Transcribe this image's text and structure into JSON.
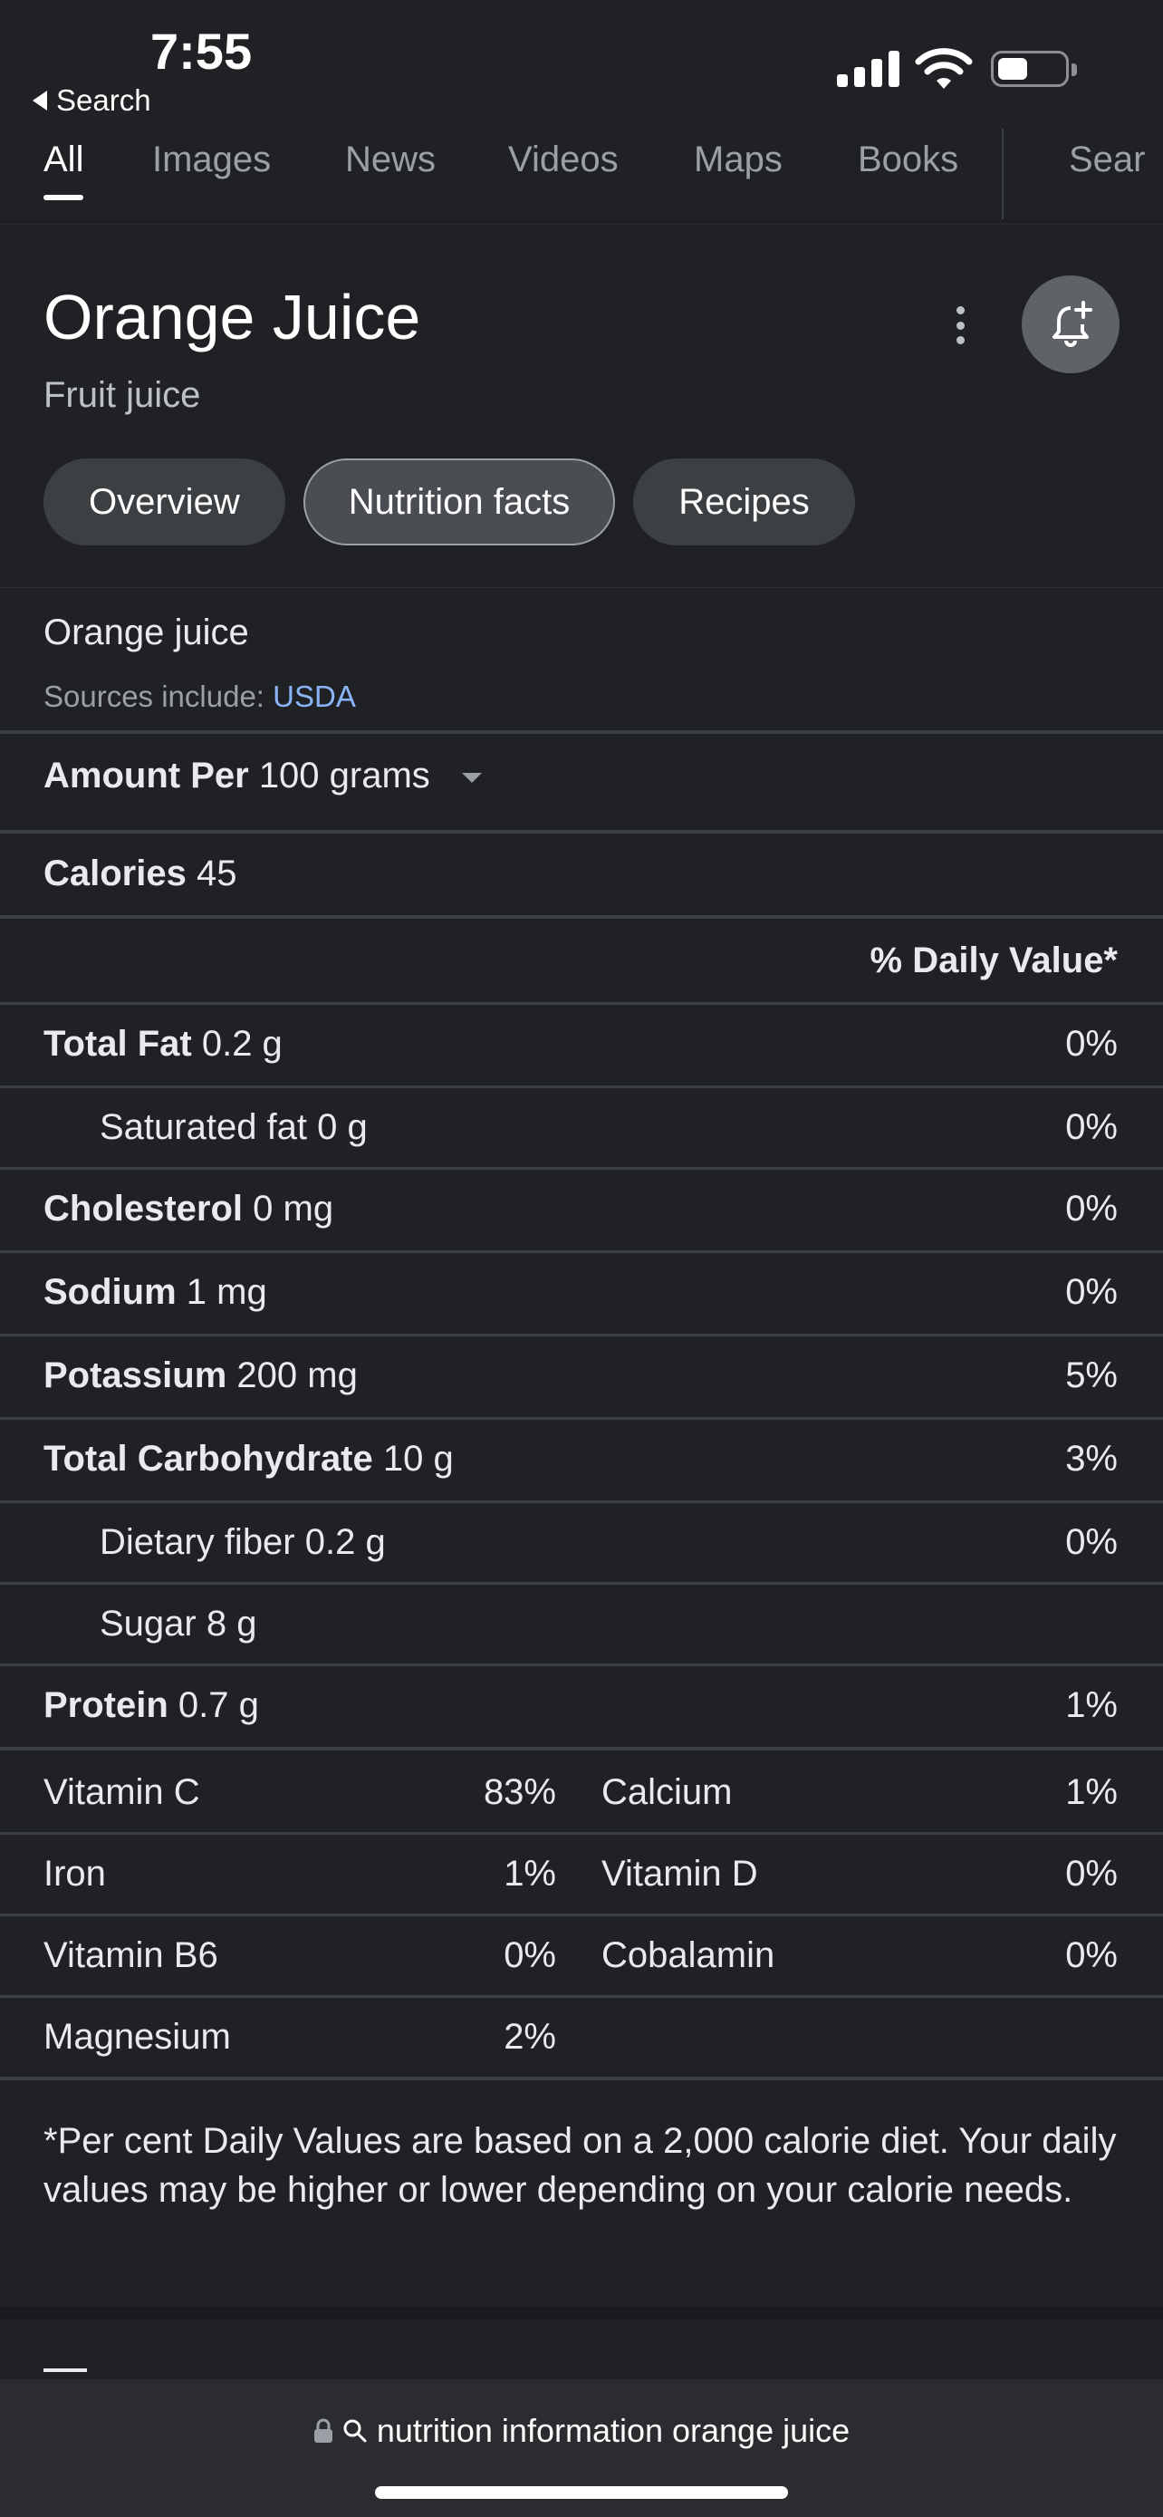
{
  "status_bar": {
    "time": "7:55",
    "back_label": "Search"
  },
  "tabs": [
    {
      "label": "All",
      "active": true
    },
    {
      "label": "Images"
    },
    {
      "label": "News"
    },
    {
      "label": "Videos"
    },
    {
      "label": "Maps"
    },
    {
      "label": "Books"
    },
    {
      "label": "Sear"
    }
  ],
  "entity": {
    "title": "Orange Juice",
    "subtitle": "Fruit juice",
    "icons": {
      "more": "more-vert-icon",
      "alert": "bell-plus-icon"
    }
  },
  "chips": [
    {
      "label": "Overview"
    },
    {
      "label": "Nutrition facts",
      "selected": true
    },
    {
      "label": "Recipes"
    }
  ],
  "source": {
    "name": "Orange juice",
    "prefix": "Sources include:",
    "link": "USDA"
  },
  "amount": {
    "label": "Amount Per",
    "value": "100 grams"
  },
  "calories": {
    "label": "Calories",
    "value": "45"
  },
  "daily_value_header": {
    "pct": "%",
    "label": "Daily Value*"
  },
  "nutrients": [
    {
      "name": "Total Fat",
      "amount": "0.2 g",
      "dv": "0%",
      "bold": true
    },
    {
      "name": "Saturated fat",
      "amount": "0 g",
      "dv": "0%",
      "bold": false
    },
    {
      "name": "Cholesterol",
      "amount": "0 mg",
      "dv": "0%",
      "bold": true
    },
    {
      "name": "Sodium",
      "amount": "1 mg",
      "dv": "0%",
      "bold": true
    },
    {
      "name": "Potassium",
      "amount": "200 mg",
      "dv": "5%",
      "bold": true
    },
    {
      "name": "Total Carbohydrate",
      "amount": "10 g",
      "dv": "3%",
      "bold": true
    },
    {
      "name": "Dietary fiber",
      "amount": "0.2 g",
      "dv": "0%",
      "bold": false
    },
    {
      "name": "Sugar",
      "amount": "8 g",
      "dv": "",
      "bold": false
    },
    {
      "name": "Protein",
      "amount": "0.7 g",
      "dv": "1%",
      "bold": true
    }
  ],
  "vitamins": [
    {
      "name": "Vitamin C",
      "value": "83%"
    },
    {
      "name": "Calcium",
      "value": "1%"
    },
    {
      "name": "Iron",
      "value": "1%"
    },
    {
      "name": "Vitamin D",
      "value": "0%"
    },
    {
      "name": "Vitamin B6",
      "value": "0%"
    },
    {
      "name": "Cobalamin",
      "value": "0%"
    },
    {
      "name": "Magnesium",
      "value": "2%"
    }
  ],
  "footnote": "*Per cent Daily Values are based on a 2,000 calorie diet. Your daily values may be higher or lower depending on your calorie needs.",
  "address_bar": {
    "query": "nutrition information orange juice"
  }
}
